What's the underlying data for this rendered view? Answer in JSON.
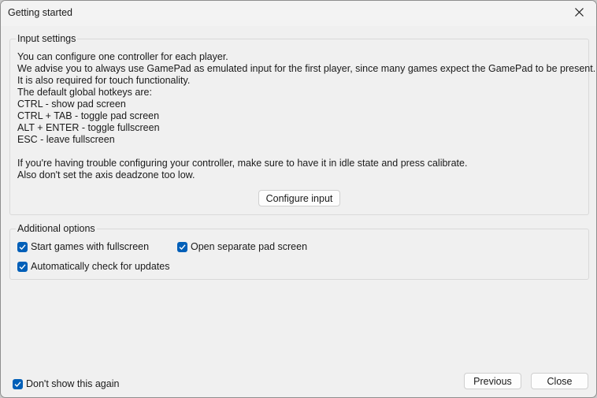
{
  "window": {
    "title": "Getting started"
  },
  "input_settings": {
    "title": "Input settings",
    "lines": [
      "You can configure one controller for each player.",
      "We advise you to always use GamePad as emulated input for the first player, since many games expect the GamePad to be present.",
      "It is also required for touch functionality.",
      "The default global hotkeys are:",
      "CTRL - show pad screen",
      "CTRL + TAB - toggle pad screen",
      "ALT + ENTER - toggle fullscreen",
      "ESC - leave fullscreen",
      "If you're having trouble configuring your controller, make sure to have it in idle state and press calibrate.",
      "Also don't set the axis deadzone too low."
    ],
    "configure_button": "Configure input"
  },
  "additional_options": {
    "title": "Additional options",
    "options": [
      {
        "label": "Start games with fullscreen",
        "checked": true
      },
      {
        "label": "Open separate pad screen",
        "checked": true
      },
      {
        "label": "Automatically check for updates",
        "checked": true
      }
    ]
  },
  "footer": {
    "dont_show_again": {
      "label": "Don't show this again",
      "checked": true
    },
    "previous_button": "Previous",
    "close_button": "Close"
  },
  "colors": {
    "accent": "#005fb8",
    "background": "#f0f0f0"
  }
}
